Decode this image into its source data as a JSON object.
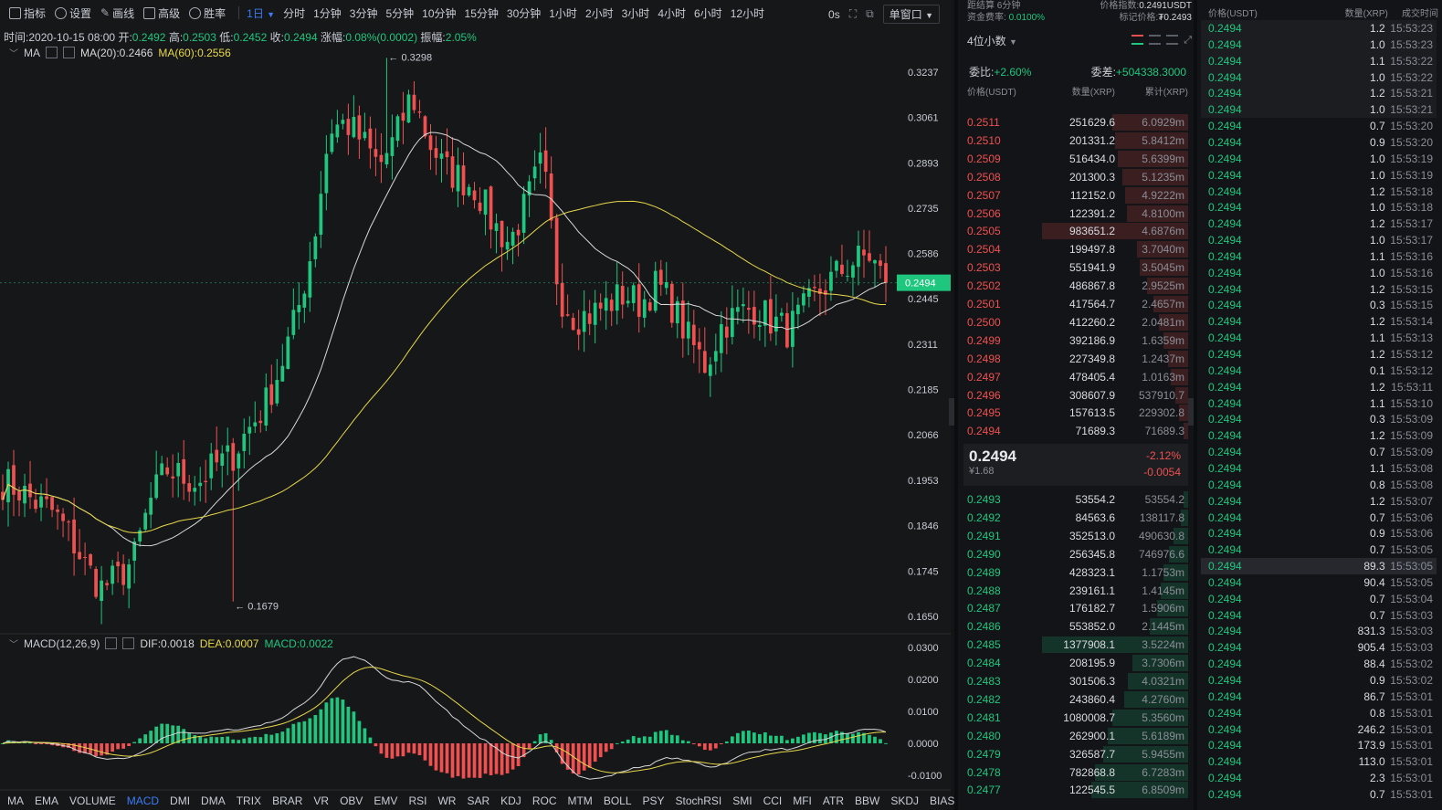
{
  "toolbar": {
    "items": [
      {
        "name": "indicator",
        "label": "指标"
      },
      {
        "name": "settings",
        "label": "设置"
      },
      {
        "name": "draw",
        "label": "画线"
      },
      {
        "name": "advanced",
        "label": "高级"
      },
      {
        "name": "winrate",
        "label": "胜率"
      }
    ],
    "active_interval": "1日",
    "intervals": [
      "分时",
      "1分钟",
      "3分钟",
      "5分钟",
      "10分钟",
      "15分钟",
      "30分钟",
      "1小时",
      "2小时",
      "3小时",
      "4小时",
      "6小时",
      "12小时"
    ],
    "countdown": "0s",
    "window_mode": "单窗口"
  },
  "ohlc": {
    "time_label": "时间:",
    "time": "2020-10-15 08:00",
    "open_label": "开:",
    "open": "0.2492",
    "high_label": "高:",
    "high": "0.2503",
    "low_label": "低:",
    "low": "0.2452",
    "close_label": "收:",
    "close": "0.2494",
    "change_label": "涨幅:",
    "change": "0.08%(0.0002)",
    "amplitude_label": "振幅:",
    "amplitude": "2.05%"
  },
  "ma_legend": {
    "name": "MA",
    "ma20": "MA(20):0.2466",
    "ma60": "MA(60):0.2556"
  },
  "macd_legend": {
    "name": "MACD(12,26,9)",
    "dif": "DIF:0.0018",
    "dea": "DEA:0.0007",
    "macd": "MACD:0.0022"
  },
  "indicator_tabs": [
    "MA",
    "EMA",
    "VOLUME",
    "MACD",
    "DMI",
    "DMA",
    "TRIX",
    "BRAR",
    "VR",
    "OBV",
    "EMV",
    "RSI",
    "WR",
    "SAR",
    "KDJ",
    "ROC",
    "MTM",
    "BOLL",
    "PSY",
    "StochRSI",
    "SMI",
    "CCI",
    "MFI",
    "ATR",
    "BBW",
    "SKDJ",
    "BIAS"
  ],
  "active_indicator": "MACD",
  "colors": {
    "up": "#1fc77e",
    "down": "#f05050",
    "accent": "#3b7cf6",
    "ma20": "#d8d8d8",
    "ma60": "#e8d84a",
    "background": "#161719"
  },
  "chart_data": {
    "type": "candlestick",
    "price_axis": [
      "0.3237",
      "0.3061",
      "0.2893",
      "0.2735",
      "0.2586",
      "0.2445",
      "0.2311",
      "0.2185",
      "0.2066",
      "0.1953",
      "0.1846",
      "0.1745",
      "0.1650"
    ],
    "price_ticks": [
      0.3237,
      0.3061,
      0.2893,
      0.2735,
      0.2586,
      0.2445,
      0.2311,
      0.2185,
      0.2066,
      0.1953,
      0.1846,
      0.1745,
      0.165
    ],
    "log_scale": true,
    "current_price_label": "0.2494",
    "current_price": 0.2494,
    "high_marker": "← 0.3298",
    "high_value": 0.3298,
    "low_marker": "← 0.1679",
    "low_value": 0.1679,
    "macd_axis": [
      "0.0300",
      "0.0200",
      "0.0100",
      "0.0000",
      "-0.0100"
    ],
    "macd_ticks": [
      0.03,
      0.02,
      0.01,
      0.0,
      -0.01
    ],
    "close_waypoints": [
      0.195,
      0.193,
      0.19,
      0.188,
      0.183,
      0.176,
      0.171,
      0.173,
      0.177,
      0.19,
      0.198,
      0.196,
      0.195,
      0.199,
      0.201,
      0.208,
      0.214,
      0.225,
      0.24,
      0.262,
      0.302,
      0.304,
      0.297,
      0.288,
      0.298,
      0.315,
      0.298,
      0.287,
      0.284,
      0.28,
      0.268,
      0.262,
      0.275,
      0.29,
      0.246,
      0.239,
      0.24,
      0.243,
      0.246,
      0.243,
      0.249,
      0.242,
      0.232,
      0.225,
      0.237,
      0.24,
      0.242,
      0.238,
      0.235,
      0.241,
      0.247,
      0.252,
      0.256,
      0.258,
      0.249
    ],
    "candle_count": 162
  },
  "orderbook": {
    "settle_label": "距结算 6分钟",
    "funding_label": "资金费率:",
    "funding": "0.0100%",
    "index_label": "价格指数:",
    "index": "0.2491USDT",
    "mark_label": "标记价格:",
    "mark": "₮0.2493",
    "precision": "4位小数",
    "ratio_label": "委比:",
    "ratio": "+2.60%",
    "diff_label": "委差:",
    "diff": "+504338.3000",
    "headers": {
      "price": "价格(USDT)",
      "qty": "数量(XRP)",
      "cum": "累计(XRP)"
    },
    "asks": [
      {
        "price": "0.2511",
        "qty": "251629.6",
        "cum": "6.0929m",
        "depth": 0.52
      },
      {
        "price": "0.2510",
        "qty": "201331.2",
        "cum": "5.8412m",
        "depth": 0.5
      },
      {
        "price": "0.2509",
        "qty": "516434.0",
        "cum": "5.6399m",
        "depth": 0.48
      },
      {
        "price": "0.2508",
        "qty": "201300.3",
        "cum": "5.1235m",
        "depth": 0.45
      },
      {
        "price": "0.2507",
        "qty": "112152.0",
        "cum": "4.9222m",
        "depth": 0.43
      },
      {
        "price": "0.2506",
        "qty": "122391.2",
        "cum": "4.8100m",
        "depth": 0.42
      },
      {
        "price": "0.2505",
        "qty": "983651.2",
        "cum": "4.6876m",
        "depth": 1.0
      },
      {
        "price": "0.2504",
        "qty": "199497.8",
        "cum": "3.7040m",
        "depth": 0.35
      },
      {
        "price": "0.2503",
        "qty": "551941.9",
        "cum": "3.5045m",
        "depth": 0.33
      },
      {
        "price": "0.2502",
        "qty": "486867.8",
        "cum": "2.9525m",
        "depth": 0.28
      },
      {
        "price": "0.2501",
        "qty": "417564.7",
        "cum": "2.4657m",
        "depth": 0.24
      },
      {
        "price": "0.2500",
        "qty": "412260.2",
        "cum": "2.0481m",
        "depth": 0.2
      },
      {
        "price": "0.2499",
        "qty": "392186.9",
        "cum": "1.6359m",
        "depth": 0.17
      },
      {
        "price": "0.2498",
        "qty": "227349.8",
        "cum": "1.2437m",
        "depth": 0.14
      },
      {
        "price": "0.2497",
        "qty": "478405.4",
        "cum": "1.0163m",
        "depth": 0.12
      },
      {
        "price": "0.2496",
        "qty": "308607.9",
        "cum": "537910.7",
        "depth": 0.09
      },
      {
        "price": "0.2495",
        "qty": "157613.5",
        "cum": "229302.8",
        "depth": 0.06
      },
      {
        "price": "0.2494",
        "qty": "71689.3",
        "cum": "71689.3",
        "depth": 0.03
      }
    ],
    "last_price": "0.2494",
    "last_cny": "¥1.68",
    "last_change_pct": "-2.12%",
    "last_change": "-0.0054",
    "bids": [
      {
        "price": "0.2493",
        "qty": "53554.2",
        "cum": "53554.2",
        "depth": 0.03
      },
      {
        "price": "0.2492",
        "qty": "84563.6",
        "cum": "138117.8",
        "depth": 0.05
      },
      {
        "price": "0.2491",
        "qty": "352513.0",
        "cum": "490630.8",
        "depth": 0.1
      },
      {
        "price": "0.2490",
        "qty": "256345.8",
        "cum": "746976.6",
        "depth": 0.13
      },
      {
        "price": "0.2489",
        "qty": "428323.1",
        "cum": "1.1753m",
        "depth": 0.17
      },
      {
        "price": "0.2488",
        "qty": "239161.1",
        "cum": "1.4145m",
        "depth": 0.19
      },
      {
        "price": "0.2487",
        "qty": "176182.7",
        "cum": "1.5906m",
        "depth": 0.21
      },
      {
        "price": "0.2486",
        "qty": "553852.0",
        "cum": "2.1445m",
        "depth": 0.26
      },
      {
        "price": "0.2485",
        "qty": "1377908.1",
        "cum": "3.5224m",
        "depth": 1.0
      },
      {
        "price": "0.2484",
        "qty": "208195.9",
        "cum": "3.7306m",
        "depth": 0.38
      },
      {
        "price": "0.2483",
        "qty": "301506.3",
        "cum": "4.0321m",
        "depth": 0.41
      },
      {
        "price": "0.2482",
        "qty": "243860.4",
        "cum": "4.2760m",
        "depth": 0.44
      },
      {
        "price": "0.2481",
        "qty": "1080008.7",
        "cum": "5.3560m",
        "depth": 0.52
      },
      {
        "price": "0.2480",
        "qty": "262900.1",
        "cum": "5.6189m",
        "depth": 0.55
      },
      {
        "price": "0.2479",
        "qty": "326587.7",
        "cum": "5.9455m",
        "depth": 0.58
      },
      {
        "price": "0.2478",
        "qty": "782868.8",
        "cum": "6.7283m",
        "depth": 0.64
      },
      {
        "price": "0.2477",
        "qty": "122545.5",
        "cum": "6.8509m",
        "depth": 0.66
      }
    ]
  },
  "trades": {
    "headers": {
      "price": "价格(USDT)",
      "qty": "数量(XRP)",
      "time": "成交时间"
    },
    "rows": [
      {
        "price": "0.2494",
        "qty": "1.2",
        "time": "15:53:23"
      },
      {
        "price": "0.2494",
        "qty": "1.0",
        "time": "15:53:23"
      },
      {
        "price": "0.2494",
        "qty": "1.1",
        "time": "15:53:22"
      },
      {
        "price": "0.2494",
        "qty": "1.0",
        "time": "15:53:22"
      },
      {
        "price": "0.2494",
        "qty": "1.2",
        "time": "15:53:21"
      },
      {
        "price": "0.2494",
        "qty": "1.0",
        "time": "15:53:21"
      },
      {
        "price": "0.2494",
        "qty": "0.7",
        "time": "15:53:20"
      },
      {
        "price": "0.2494",
        "qty": "0.9",
        "time": "15:53:20"
      },
      {
        "price": "0.2494",
        "qty": "1.0",
        "time": "15:53:19"
      },
      {
        "price": "0.2494",
        "qty": "1.0",
        "time": "15:53:19"
      },
      {
        "price": "0.2494",
        "qty": "1.2",
        "time": "15:53:18"
      },
      {
        "price": "0.2494",
        "qty": "1.0",
        "time": "15:53:18"
      },
      {
        "price": "0.2494",
        "qty": "1.2",
        "time": "15:53:17"
      },
      {
        "price": "0.2494",
        "qty": "1.0",
        "time": "15:53:17"
      },
      {
        "price": "0.2494",
        "qty": "1.1",
        "time": "15:53:16"
      },
      {
        "price": "0.2494",
        "qty": "1.0",
        "time": "15:53:16"
      },
      {
        "price": "0.2494",
        "qty": "1.2",
        "time": "15:53:15"
      },
      {
        "price": "0.2494",
        "qty": "0.3",
        "time": "15:53:15"
      },
      {
        "price": "0.2494",
        "qty": "1.2",
        "time": "15:53:14"
      },
      {
        "price": "0.2494",
        "qty": "1.1",
        "time": "15:53:13"
      },
      {
        "price": "0.2494",
        "qty": "1.2",
        "time": "15:53:12"
      },
      {
        "price": "0.2494",
        "qty": "0.1",
        "time": "15:53:12"
      },
      {
        "price": "0.2494",
        "qty": "1.2",
        "time": "15:53:11"
      },
      {
        "price": "0.2494",
        "qty": "1.1",
        "time": "15:53:10"
      },
      {
        "price": "0.2494",
        "qty": "0.3",
        "time": "15:53:09"
      },
      {
        "price": "0.2494",
        "qty": "1.2",
        "time": "15:53:09"
      },
      {
        "price": "0.2494",
        "qty": "0.7",
        "time": "15:53:09"
      },
      {
        "price": "0.2494",
        "qty": "1.1",
        "time": "15:53:08"
      },
      {
        "price": "0.2494",
        "qty": "0.8",
        "time": "15:53:08"
      },
      {
        "price": "0.2494",
        "qty": "1.2",
        "time": "15:53:07"
      },
      {
        "price": "0.2494",
        "qty": "0.7",
        "time": "15:53:06"
      },
      {
        "price": "0.2494",
        "qty": "0.9",
        "time": "15:53:06"
      },
      {
        "price": "0.2494",
        "qty": "0.7",
        "time": "15:53:05"
      },
      {
        "price": "0.2494",
        "qty": "89.3",
        "time": "15:53:05"
      },
      {
        "price": "0.2494",
        "qty": "90.4",
        "time": "15:53:05"
      },
      {
        "price": "0.2494",
        "qty": "0.7",
        "time": "15:53:04"
      },
      {
        "price": "0.2494",
        "qty": "0.7",
        "time": "15:53:03"
      },
      {
        "price": "0.2494",
        "qty": "831.3",
        "time": "15:53:03"
      },
      {
        "price": "0.2494",
        "qty": "905.4",
        "time": "15:53:03"
      },
      {
        "price": "0.2494",
        "qty": "88.4",
        "time": "15:53:02"
      },
      {
        "price": "0.2494",
        "qty": "0.9",
        "time": "15:53:02"
      },
      {
        "price": "0.2494",
        "qty": "86.7",
        "time": "15:53:01"
      },
      {
        "price": "0.2494",
        "qty": "0.8",
        "time": "15:53:01"
      },
      {
        "price": "0.2494",
        "qty": "246.2",
        "time": "15:53:01"
      },
      {
        "price": "0.2494",
        "qty": "173.9",
        "time": "15:53:01"
      },
      {
        "price": "0.2494",
        "qty": "113.0",
        "time": "15:53:01"
      },
      {
        "price": "0.2494",
        "qty": "2.3",
        "time": "15:53:01"
      },
      {
        "price": "0.2494",
        "qty": "0.7",
        "time": "15:53:01"
      }
    ]
  }
}
